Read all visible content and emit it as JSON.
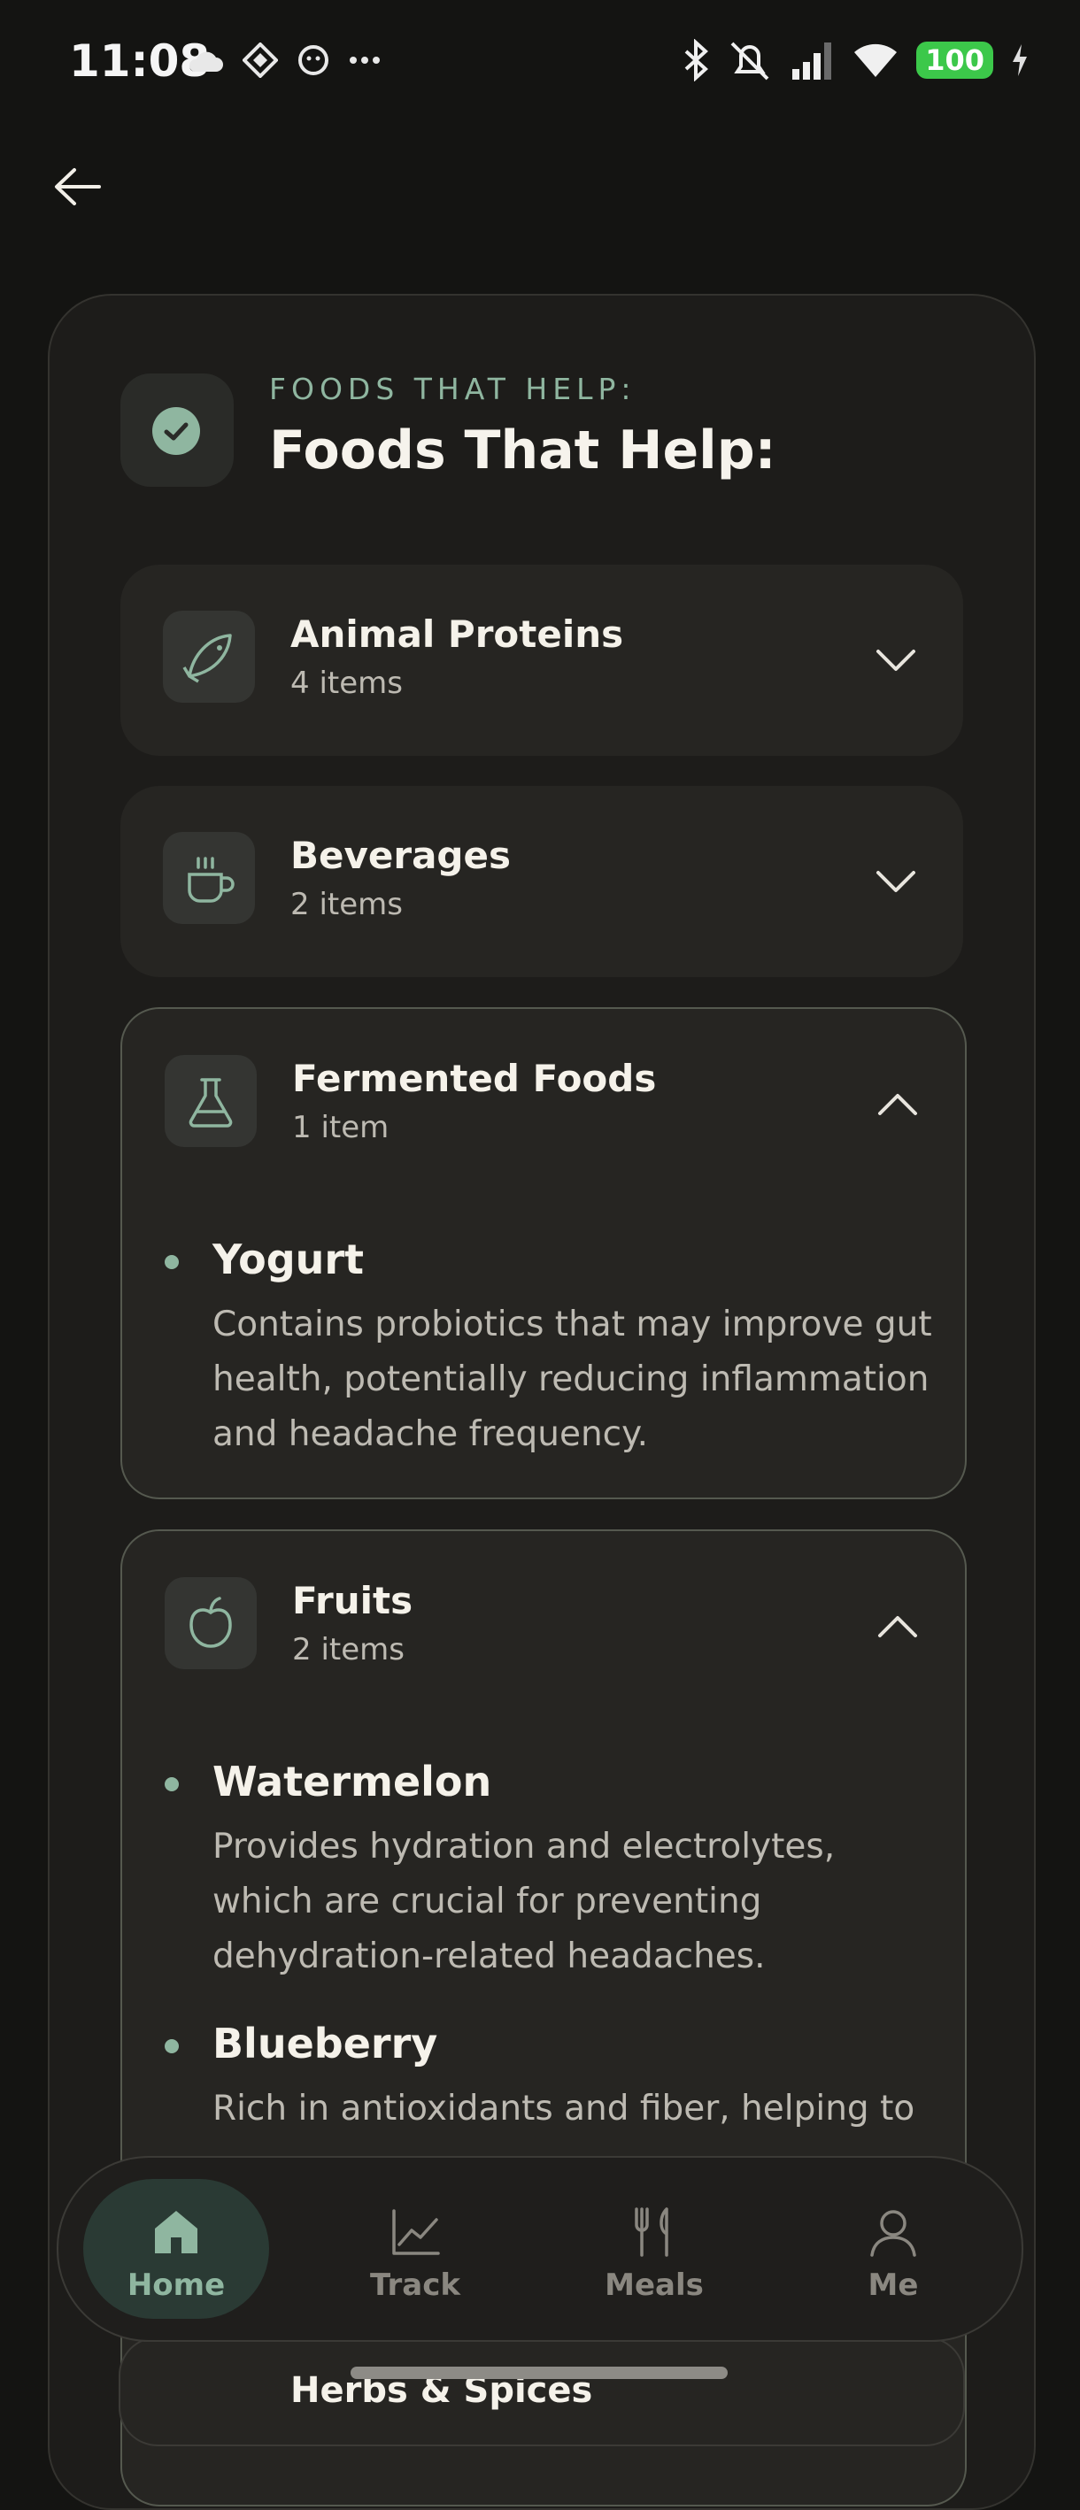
{
  "status_bar": {
    "time": "11:08",
    "battery": "100"
  },
  "header": {
    "eyebrow": "FOODS THAT HELP:",
    "title": "Foods That Help:"
  },
  "groups": [
    {
      "title": "Animal Proteins",
      "count": "4 items",
      "icon": "fish-icon",
      "expanded": false
    },
    {
      "title": "Beverages",
      "count": "2 items",
      "icon": "coffee-cup-icon",
      "expanded": false
    },
    {
      "title": "Fermented Foods",
      "count": "1 item",
      "icon": "flask-icon",
      "expanded": true,
      "items": [
        {
          "name": "Yogurt",
          "desc": "Contains probiotics that may improve gut health, potentially reducing inflammation and headache frequency."
        }
      ]
    },
    {
      "title": "Fruits",
      "count": "2 items",
      "icon": "apple-icon",
      "expanded": true,
      "items": [
        {
          "name": "Watermelon",
          "desc": "Provides hydration and electrolytes, which are crucial for preventing dehydration-related headaches."
        },
        {
          "name": "Blueberry",
          "desc": "Rich in antioxidants and fiber, helping to"
        }
      ]
    },
    {
      "title": "Herbs & Spices",
      "icon": "leaf-icon"
    }
  ],
  "nav": [
    {
      "label": "Home",
      "icon": "home-icon",
      "active": true
    },
    {
      "label": "Track",
      "icon": "chart-line-icon",
      "active": false
    },
    {
      "label": "Meals",
      "icon": "fork-knife-icon",
      "active": false
    },
    {
      "label": "Me",
      "icon": "user-icon",
      "active": false
    }
  ],
  "colors": {
    "accent": "#8fb6a0",
    "background": "#141412",
    "card": "#1d1c1a"
  }
}
